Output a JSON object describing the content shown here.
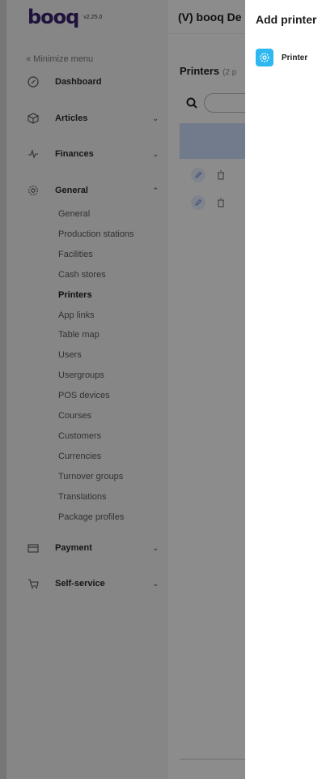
{
  "app": {
    "logo_text": "booq",
    "version": "v2.25.0",
    "title": "(V) booq De"
  },
  "sidebar": {
    "minimize_label": "« Minimize menu",
    "items": [
      {
        "label": "Dashboard",
        "icon": "dashboard-icon",
        "has_chevron": false
      },
      {
        "label": "Articles",
        "icon": "box-icon",
        "chevron": "chevron-down"
      },
      {
        "label": "Finances",
        "icon": "pulse-icon",
        "chevron": "chevron-down"
      },
      {
        "label": "General",
        "icon": "gear-icon",
        "chevron": "chevron-up"
      },
      {
        "label": "Payment",
        "icon": "card-icon",
        "chevron": "chevron-down"
      },
      {
        "label": "Self-service",
        "icon": "cart-icon",
        "chevron": "chevron-down"
      }
    ],
    "general_subitems": [
      "General",
      "Production stations",
      "Facilities",
      "Cash stores",
      "Printers",
      "App links",
      "Table map",
      "Users",
      "Usergroups",
      "POS devices",
      "Courses",
      "Customers",
      "Currencies",
      "Turnover groups",
      "Translations",
      "Package profiles"
    ],
    "active_subitem": "Printers"
  },
  "main": {
    "page_title": "Printers",
    "page_count": "(2 p",
    "row_count": 2
  },
  "panel": {
    "title": "Add printer",
    "option_label": "Printer",
    "option_icon": "gear-icon",
    "option_icon_color": "#2fb8f0"
  }
}
